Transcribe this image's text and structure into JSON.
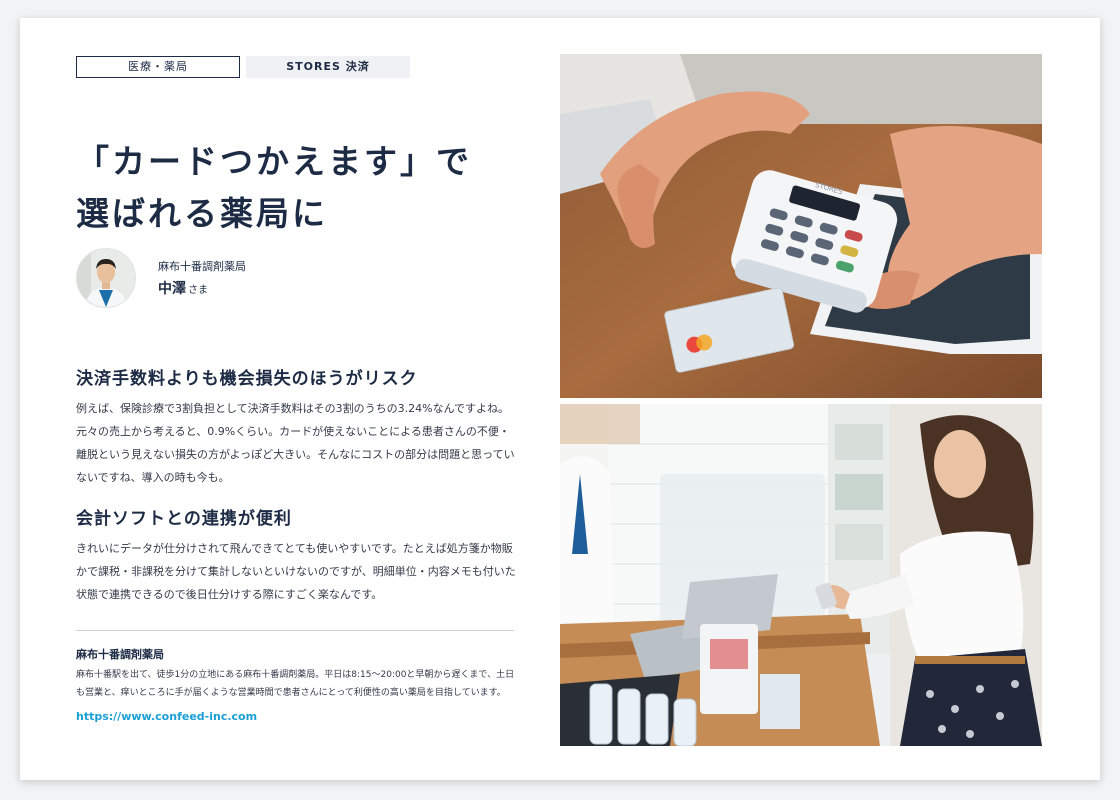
{
  "tags": [
    "医療・薬局",
    "STORES 決済"
  ],
  "title_lines": [
    "「カードつかえます」で",
    "選ばれる薬局に"
  ],
  "author": {
    "org": "麻布十番調剤薬局",
    "name": "中澤",
    "suffix": "さま"
  },
  "sections": [
    {
      "heading": "決済手数料よりも機会損失のほうがリスク",
      "body": "例えば、保険診療で3割負担として決済手数料はその3割のうちの3.24%なんですよね。元々の売上から考えると、0.9%くらい。カードが使えないことによる患者さんの不便・離脱という見えない損失の方がよっぽど大きい。そんなにコストの部分は問題と思っていないですね、導入の時も今も。"
    },
    {
      "heading": "会計ソフトとの連携が便利",
      "body": "きれいにデータが仕分けされて飛んできてとても使いやすいです。たとえば処方箋か物販かで課税・非課税を分けて集計しないといけないのですが、明細単位・内容メモも付いた状態で連携できるので後日仕分けする際にすごく楽なんです。"
    }
  ],
  "info": {
    "title": "麻布十番調剤薬局",
    "text": "麻布十番駅を出て、徒歩1分の立地にある麻布十番調剤薬局。平日は8:15〜20:00と早朝から遅くまで、土日も営業と、痒いところに手が届くような営業時間で患者さんにとって利便性の高い薬局を目指しています。",
    "link": "https://www.confeed-inc.com"
  },
  "terminal_brand": "STORES",
  "colors": {
    "navy": "#1d2b45",
    "link": "#1a9fd6",
    "tag_fill": "#f0f1f4"
  }
}
